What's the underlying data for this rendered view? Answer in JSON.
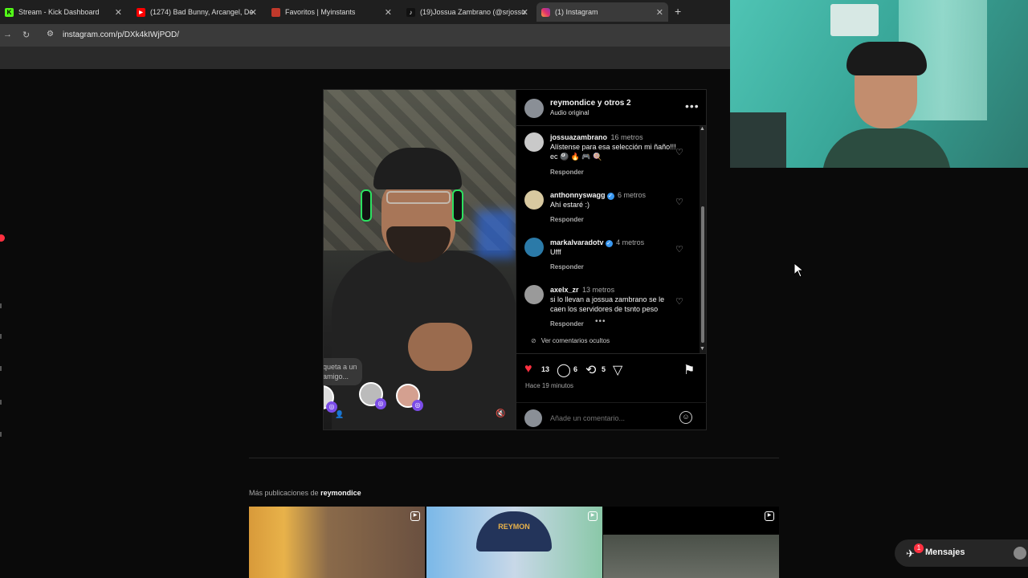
{
  "browser": {
    "tabs": [
      {
        "label": "Stream - Kick Dashboard",
        "favicon": "kick-icon",
        "color": "#53fc18"
      },
      {
        "label": "(1274) Bad Bunny, Arcangel, De",
        "favicon": "youtube-icon",
        "color": "#ff0000"
      },
      {
        "label": "Favoritos | Myinstants",
        "favicon": "myinstants-icon",
        "color": "#c0392b"
      },
      {
        "label": "(19)Jossua Zambrano (@srjossu",
        "favicon": "tiktok-icon",
        "color": "#111111"
      },
      {
        "label": "(1) Instagram",
        "favicon": "instagram-icon",
        "color": "#e1306c"
      }
    ],
    "url": "instagram.com/p/DXk4kIWjPOD/"
  },
  "post": {
    "author": "reymondice y otros 2",
    "audio": "Audio original",
    "tag_prompt": "Etiqueta a un amigo...",
    "comments": [
      {
        "user": "jossuazambrano",
        "verified": false,
        "time": "16 metros",
        "text": "Alístense para esa selección mi ñaño!!! ec 🎱 🔥 🎮 🍭",
        "reply": "Responder"
      },
      {
        "user": "anthonnyswagg",
        "verified": true,
        "time": "6 metros",
        "text": "Ahí estaré :)",
        "reply": "Responder"
      },
      {
        "user": "markalvaradotv",
        "verified": true,
        "time": "4 metros",
        "text": "Ufff",
        "reply": "Responder"
      },
      {
        "user": "axelx_zr",
        "verified": false,
        "time": "13 metros",
        "text": "si lo llevan a jossua zambrano se le caen los servidores de tsnto peso",
        "reply": "Responder"
      }
    ],
    "hidden_comments": "Ver comentarios ocultos",
    "likes": "13",
    "comment_count": "6",
    "reposts": "5",
    "time_ago": "Hace 19 minutos",
    "add_comment_placeholder": "Añade un comentario..."
  },
  "more_posts": {
    "prefix": "Más publicaciones de",
    "user": "reymondice",
    "thumb2_text": "REYMON"
  },
  "messages": {
    "label": "Mensajes",
    "badge": "1"
  },
  "colors": {
    "like_red": "#ff3040",
    "verified_blue": "#3897f0",
    "background": "#000000"
  }
}
